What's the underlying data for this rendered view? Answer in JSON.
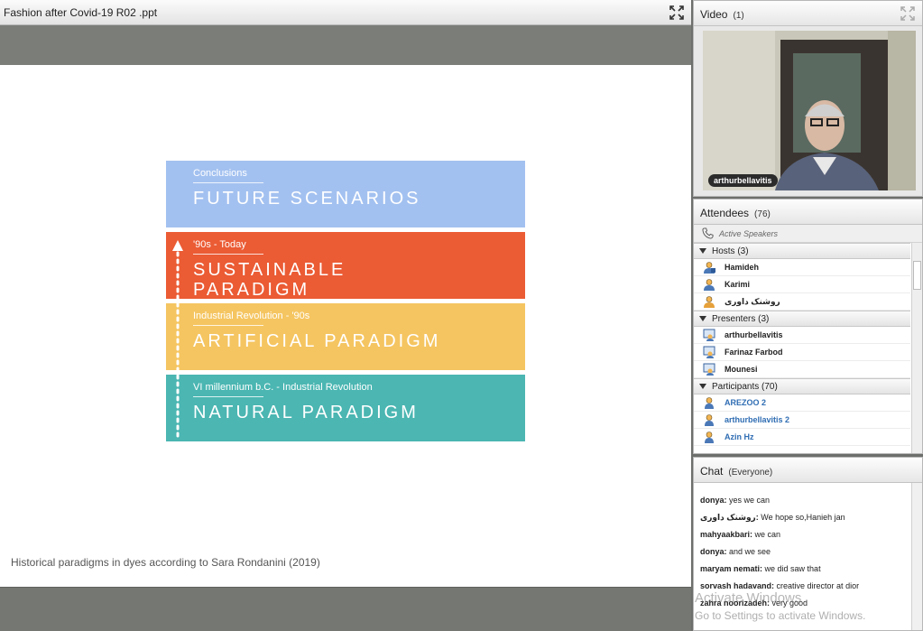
{
  "share": {
    "title": "Fashion after Covid-19 R02 .ppt",
    "bands": [
      {
        "label": "Conclusions",
        "title": "FUTURE SCENARIOS",
        "color": "#a3c1f0"
      },
      {
        "label": "'90s - Today",
        "title": "SUSTAINABLE PARADIGM",
        "color": "#eb5b34"
      },
      {
        "label": "Industrial Revolution - '90s",
        "title": "ARTIFICIAL PARADIGM",
        "color": "#f5c561"
      },
      {
        "label": "VI millennium b.C. - Industrial Revolution",
        "title": "NATURAL PARADIGM",
        "color": "#4bb6b2"
      }
    ],
    "caption": "Historical paradigms in dyes according to Sara Rondanini (2019)"
  },
  "video": {
    "title": "Video",
    "count": "(1)",
    "speaker": "arthurbellavitis"
  },
  "attendees": {
    "title": "Attendees",
    "count": "(76)",
    "active_speakers": "Active Speakers",
    "groups": [
      {
        "label": "Hosts (3)",
        "members": [
          {
            "name": "Hamideh",
            "icon": "host-icon"
          },
          {
            "name": "Karimi",
            "icon": "host-icon"
          },
          {
            "name": "روشنک داوری",
            "icon": "host-icon"
          }
        ]
      },
      {
        "label": "Presenters (3)",
        "members": [
          {
            "name": "arthurbellavitis",
            "icon": "presenter-icon"
          },
          {
            "name": "Farinaz Farbod",
            "icon": "presenter-icon"
          },
          {
            "name": "Mounesi",
            "icon": "presenter-icon"
          }
        ]
      },
      {
        "label": "Participants (70)",
        "members": [
          {
            "name": "AREZOO 2",
            "icon": "participant-icon"
          },
          {
            "name": "arthurbellavitis 2",
            "icon": "participant-icon"
          },
          {
            "name": "Azin Hz",
            "icon": "participant-icon"
          }
        ]
      }
    ]
  },
  "chat": {
    "title": "Chat",
    "scope": "(Everyone)",
    "messages": [
      {
        "sender": "donya:",
        "text": " yes we can"
      },
      {
        "sender": "روشنک داوری:",
        "text": " We hope so,Hanieh jan"
      },
      {
        "sender": "mahyaakbari:",
        "text": " we can"
      },
      {
        "sender": "donya:",
        "text": " and we see"
      },
      {
        "sender": "maryam nemati:",
        "text": " we did saw that"
      },
      {
        "sender": "sorvash hadavand:",
        "text": " creative director at dior"
      },
      {
        "sender": "zahra noorizadeh:",
        "text": " very good"
      }
    ]
  },
  "watermark": {
    "line1": "Activate Windows",
    "line2": "Go to Settings to activate Windows."
  },
  "colors": {
    "header_bg": "#f0f0f0",
    "blue_name": "#2f6db3"
  }
}
